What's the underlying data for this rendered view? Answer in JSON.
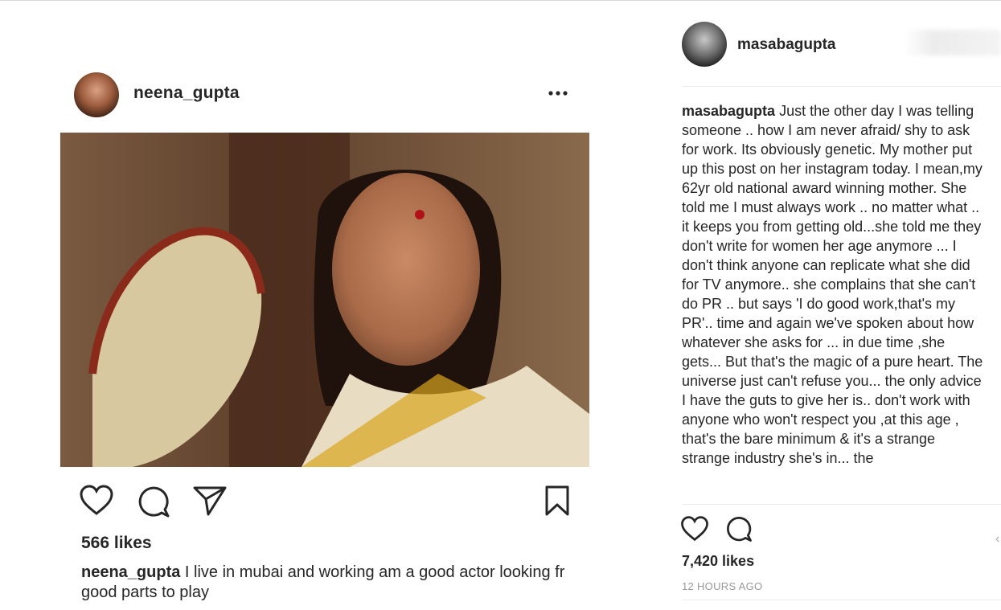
{
  "left_post": {
    "username": "neena_gupta",
    "likes": "566 likes",
    "caption_user": "neena_gupta",
    "caption_text": "I live in mubai and working am a good actor looking fr good parts to play"
  },
  "right_post": {
    "username": "masabagupta",
    "caption_user": "masabagupta",
    "caption_text": "Just the other day I was telling someone .. how I am never afraid/ shy to ask for work. Its obviously genetic. My mother put up this post on her instagram today. I mean,my 62yr old national award winning mother. She told me I must always work .. no matter what .. it keeps you from getting old...she told me they don't write for women her age anymore ... I don't think anyone can replicate what she did for TV anymore.. she complains that she can't do PR .. but says 'I do good work,that's my PR'.. time and again we've spoken about how whatever she asks for ... in due time ,she gets... But that's the magic of a pure heart. The universe just can't refuse you... the only advice I have the guts to give her is.. don't work with anyone who won't respect you ,at this age , that's the bare minimum & it's a strange strange industry she's in... the",
    "likes": "7,420 likes",
    "time": "12 HOURS AGO"
  },
  "icons": [
    "more-icon",
    "heart-icon",
    "comment-icon",
    "share-icon",
    "bookmark-icon"
  ],
  "colors": {
    "text": "#262626",
    "muted": "#999999",
    "divider": "#ebebeb"
  }
}
